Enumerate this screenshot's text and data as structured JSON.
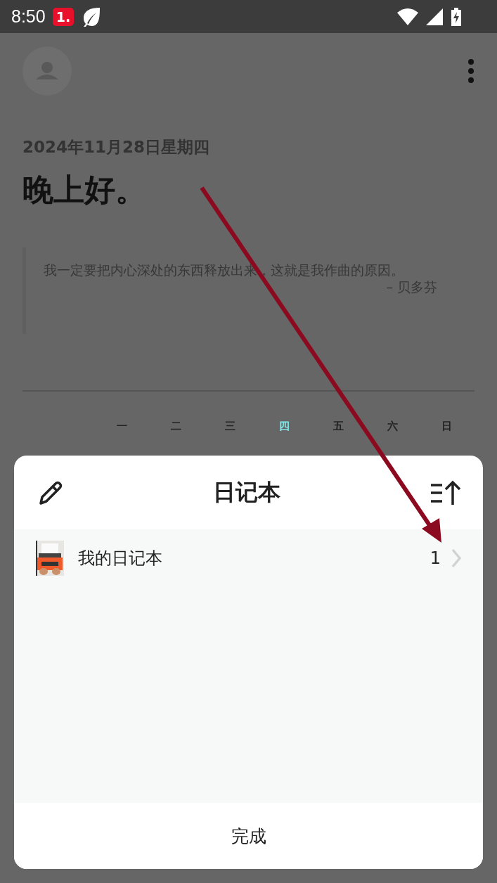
{
  "status_bar": {
    "time": "8:50",
    "badge": "1."
  },
  "header": {
    "date": "2024年11月28日星期四",
    "greeting": "晚上好。"
  },
  "quote": {
    "text": "我一定要把内心深处的东西释放出来，这就是我作曲的原因。",
    "author": "– 贝多芬"
  },
  "weekdays": [
    {
      "label": "一",
      "selected": false
    },
    {
      "label": "二",
      "selected": false
    },
    {
      "label": "三",
      "selected": false
    },
    {
      "label": "四",
      "selected": true
    },
    {
      "label": "五",
      "selected": false
    },
    {
      "label": "六",
      "selected": false
    },
    {
      "label": "日",
      "selected": false
    }
  ],
  "sheet": {
    "title": "日记本",
    "notebooks": [
      {
        "name": "我的日记本",
        "count": "1"
      }
    ],
    "done_button": "完成"
  }
}
